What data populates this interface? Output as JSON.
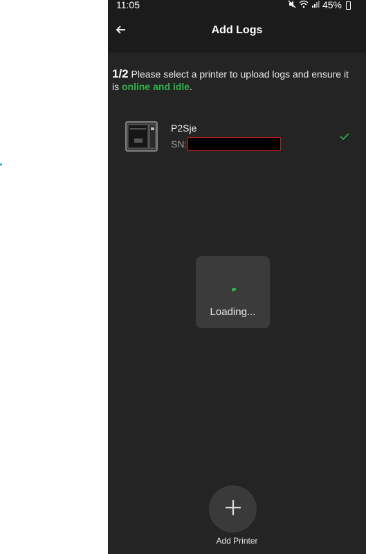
{
  "status_bar": {
    "time": "11:05",
    "battery": "45%",
    "icons": [
      "mute-icon",
      "wifi-icon",
      "signal-icon",
      "battery-icon"
    ]
  },
  "app_bar": {
    "title": "Add Logs",
    "back_icon": "back-arrow-icon"
  },
  "instructions": {
    "step": "1/2",
    "text_before": "Please select a printer to upload logs and ensure it is ",
    "highlight": "online and idle",
    "text_after": "."
  },
  "printer": {
    "name": "P2Sje",
    "sn_label": "SN:",
    "selected": true
  },
  "loading": {
    "text": "Loading..."
  },
  "add_printer": {
    "label": "Add Printer",
    "icon": "plus-icon"
  },
  "colors": {
    "accent_green": "#2bb44a",
    "background": "#242424",
    "app_bar": "#1b1b1b",
    "redaction_border": "#c21a1a"
  }
}
